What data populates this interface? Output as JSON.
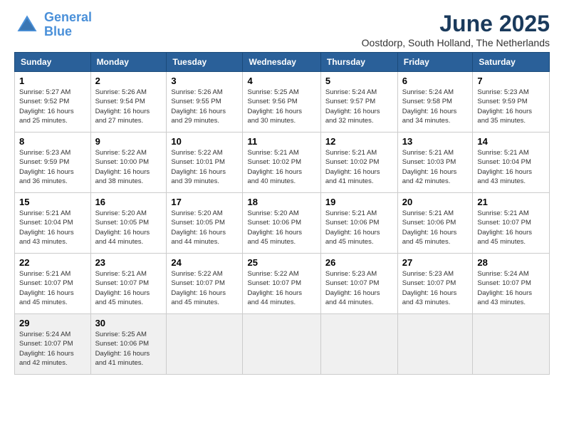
{
  "header": {
    "logo_line1": "General",
    "logo_line2": "Blue",
    "month": "June 2025",
    "location": "Oostdorp, South Holland, The Netherlands"
  },
  "days_of_week": [
    "Sunday",
    "Monday",
    "Tuesday",
    "Wednesday",
    "Thursday",
    "Friday",
    "Saturday"
  ],
  "weeks": [
    [
      {
        "day": "1",
        "info": "Sunrise: 5:27 AM\nSunset: 9:52 PM\nDaylight: 16 hours\nand 25 minutes."
      },
      {
        "day": "2",
        "info": "Sunrise: 5:26 AM\nSunset: 9:54 PM\nDaylight: 16 hours\nand 27 minutes."
      },
      {
        "day": "3",
        "info": "Sunrise: 5:26 AM\nSunset: 9:55 PM\nDaylight: 16 hours\nand 29 minutes."
      },
      {
        "day": "4",
        "info": "Sunrise: 5:25 AM\nSunset: 9:56 PM\nDaylight: 16 hours\nand 30 minutes."
      },
      {
        "day": "5",
        "info": "Sunrise: 5:24 AM\nSunset: 9:57 PM\nDaylight: 16 hours\nand 32 minutes."
      },
      {
        "day": "6",
        "info": "Sunrise: 5:24 AM\nSunset: 9:58 PM\nDaylight: 16 hours\nand 34 minutes."
      },
      {
        "day": "7",
        "info": "Sunrise: 5:23 AM\nSunset: 9:59 PM\nDaylight: 16 hours\nand 35 minutes."
      }
    ],
    [
      {
        "day": "8",
        "info": "Sunrise: 5:23 AM\nSunset: 9:59 PM\nDaylight: 16 hours\nand 36 minutes."
      },
      {
        "day": "9",
        "info": "Sunrise: 5:22 AM\nSunset: 10:00 PM\nDaylight: 16 hours\nand 38 minutes."
      },
      {
        "day": "10",
        "info": "Sunrise: 5:22 AM\nSunset: 10:01 PM\nDaylight: 16 hours\nand 39 minutes."
      },
      {
        "day": "11",
        "info": "Sunrise: 5:21 AM\nSunset: 10:02 PM\nDaylight: 16 hours\nand 40 minutes."
      },
      {
        "day": "12",
        "info": "Sunrise: 5:21 AM\nSunset: 10:02 PM\nDaylight: 16 hours\nand 41 minutes."
      },
      {
        "day": "13",
        "info": "Sunrise: 5:21 AM\nSunset: 10:03 PM\nDaylight: 16 hours\nand 42 minutes."
      },
      {
        "day": "14",
        "info": "Sunrise: 5:21 AM\nSunset: 10:04 PM\nDaylight: 16 hours\nand 43 minutes."
      }
    ],
    [
      {
        "day": "15",
        "info": "Sunrise: 5:21 AM\nSunset: 10:04 PM\nDaylight: 16 hours\nand 43 minutes."
      },
      {
        "day": "16",
        "info": "Sunrise: 5:20 AM\nSunset: 10:05 PM\nDaylight: 16 hours\nand 44 minutes."
      },
      {
        "day": "17",
        "info": "Sunrise: 5:20 AM\nSunset: 10:05 PM\nDaylight: 16 hours\nand 44 minutes."
      },
      {
        "day": "18",
        "info": "Sunrise: 5:20 AM\nSunset: 10:06 PM\nDaylight: 16 hours\nand 45 minutes."
      },
      {
        "day": "19",
        "info": "Sunrise: 5:21 AM\nSunset: 10:06 PM\nDaylight: 16 hours\nand 45 minutes."
      },
      {
        "day": "20",
        "info": "Sunrise: 5:21 AM\nSunset: 10:06 PM\nDaylight: 16 hours\nand 45 minutes."
      },
      {
        "day": "21",
        "info": "Sunrise: 5:21 AM\nSunset: 10:07 PM\nDaylight: 16 hours\nand 45 minutes."
      }
    ],
    [
      {
        "day": "22",
        "info": "Sunrise: 5:21 AM\nSunset: 10:07 PM\nDaylight: 16 hours\nand 45 minutes."
      },
      {
        "day": "23",
        "info": "Sunrise: 5:21 AM\nSunset: 10:07 PM\nDaylight: 16 hours\nand 45 minutes."
      },
      {
        "day": "24",
        "info": "Sunrise: 5:22 AM\nSunset: 10:07 PM\nDaylight: 16 hours\nand 45 minutes."
      },
      {
        "day": "25",
        "info": "Sunrise: 5:22 AM\nSunset: 10:07 PM\nDaylight: 16 hours\nand 44 minutes."
      },
      {
        "day": "26",
        "info": "Sunrise: 5:23 AM\nSunset: 10:07 PM\nDaylight: 16 hours\nand 44 minutes."
      },
      {
        "day": "27",
        "info": "Sunrise: 5:23 AM\nSunset: 10:07 PM\nDaylight: 16 hours\nand 43 minutes."
      },
      {
        "day": "28",
        "info": "Sunrise: 5:24 AM\nSunset: 10:07 PM\nDaylight: 16 hours\nand 43 minutes."
      }
    ],
    [
      {
        "day": "29",
        "info": "Sunrise: 5:24 AM\nSunset: 10:07 PM\nDaylight: 16 hours\nand 42 minutes."
      },
      {
        "day": "30",
        "info": "Sunrise: 5:25 AM\nSunset: 10:06 PM\nDaylight: 16 hours\nand 41 minutes."
      },
      {
        "day": "",
        "info": ""
      },
      {
        "day": "",
        "info": ""
      },
      {
        "day": "",
        "info": ""
      },
      {
        "day": "",
        "info": ""
      },
      {
        "day": "",
        "info": ""
      }
    ]
  ]
}
